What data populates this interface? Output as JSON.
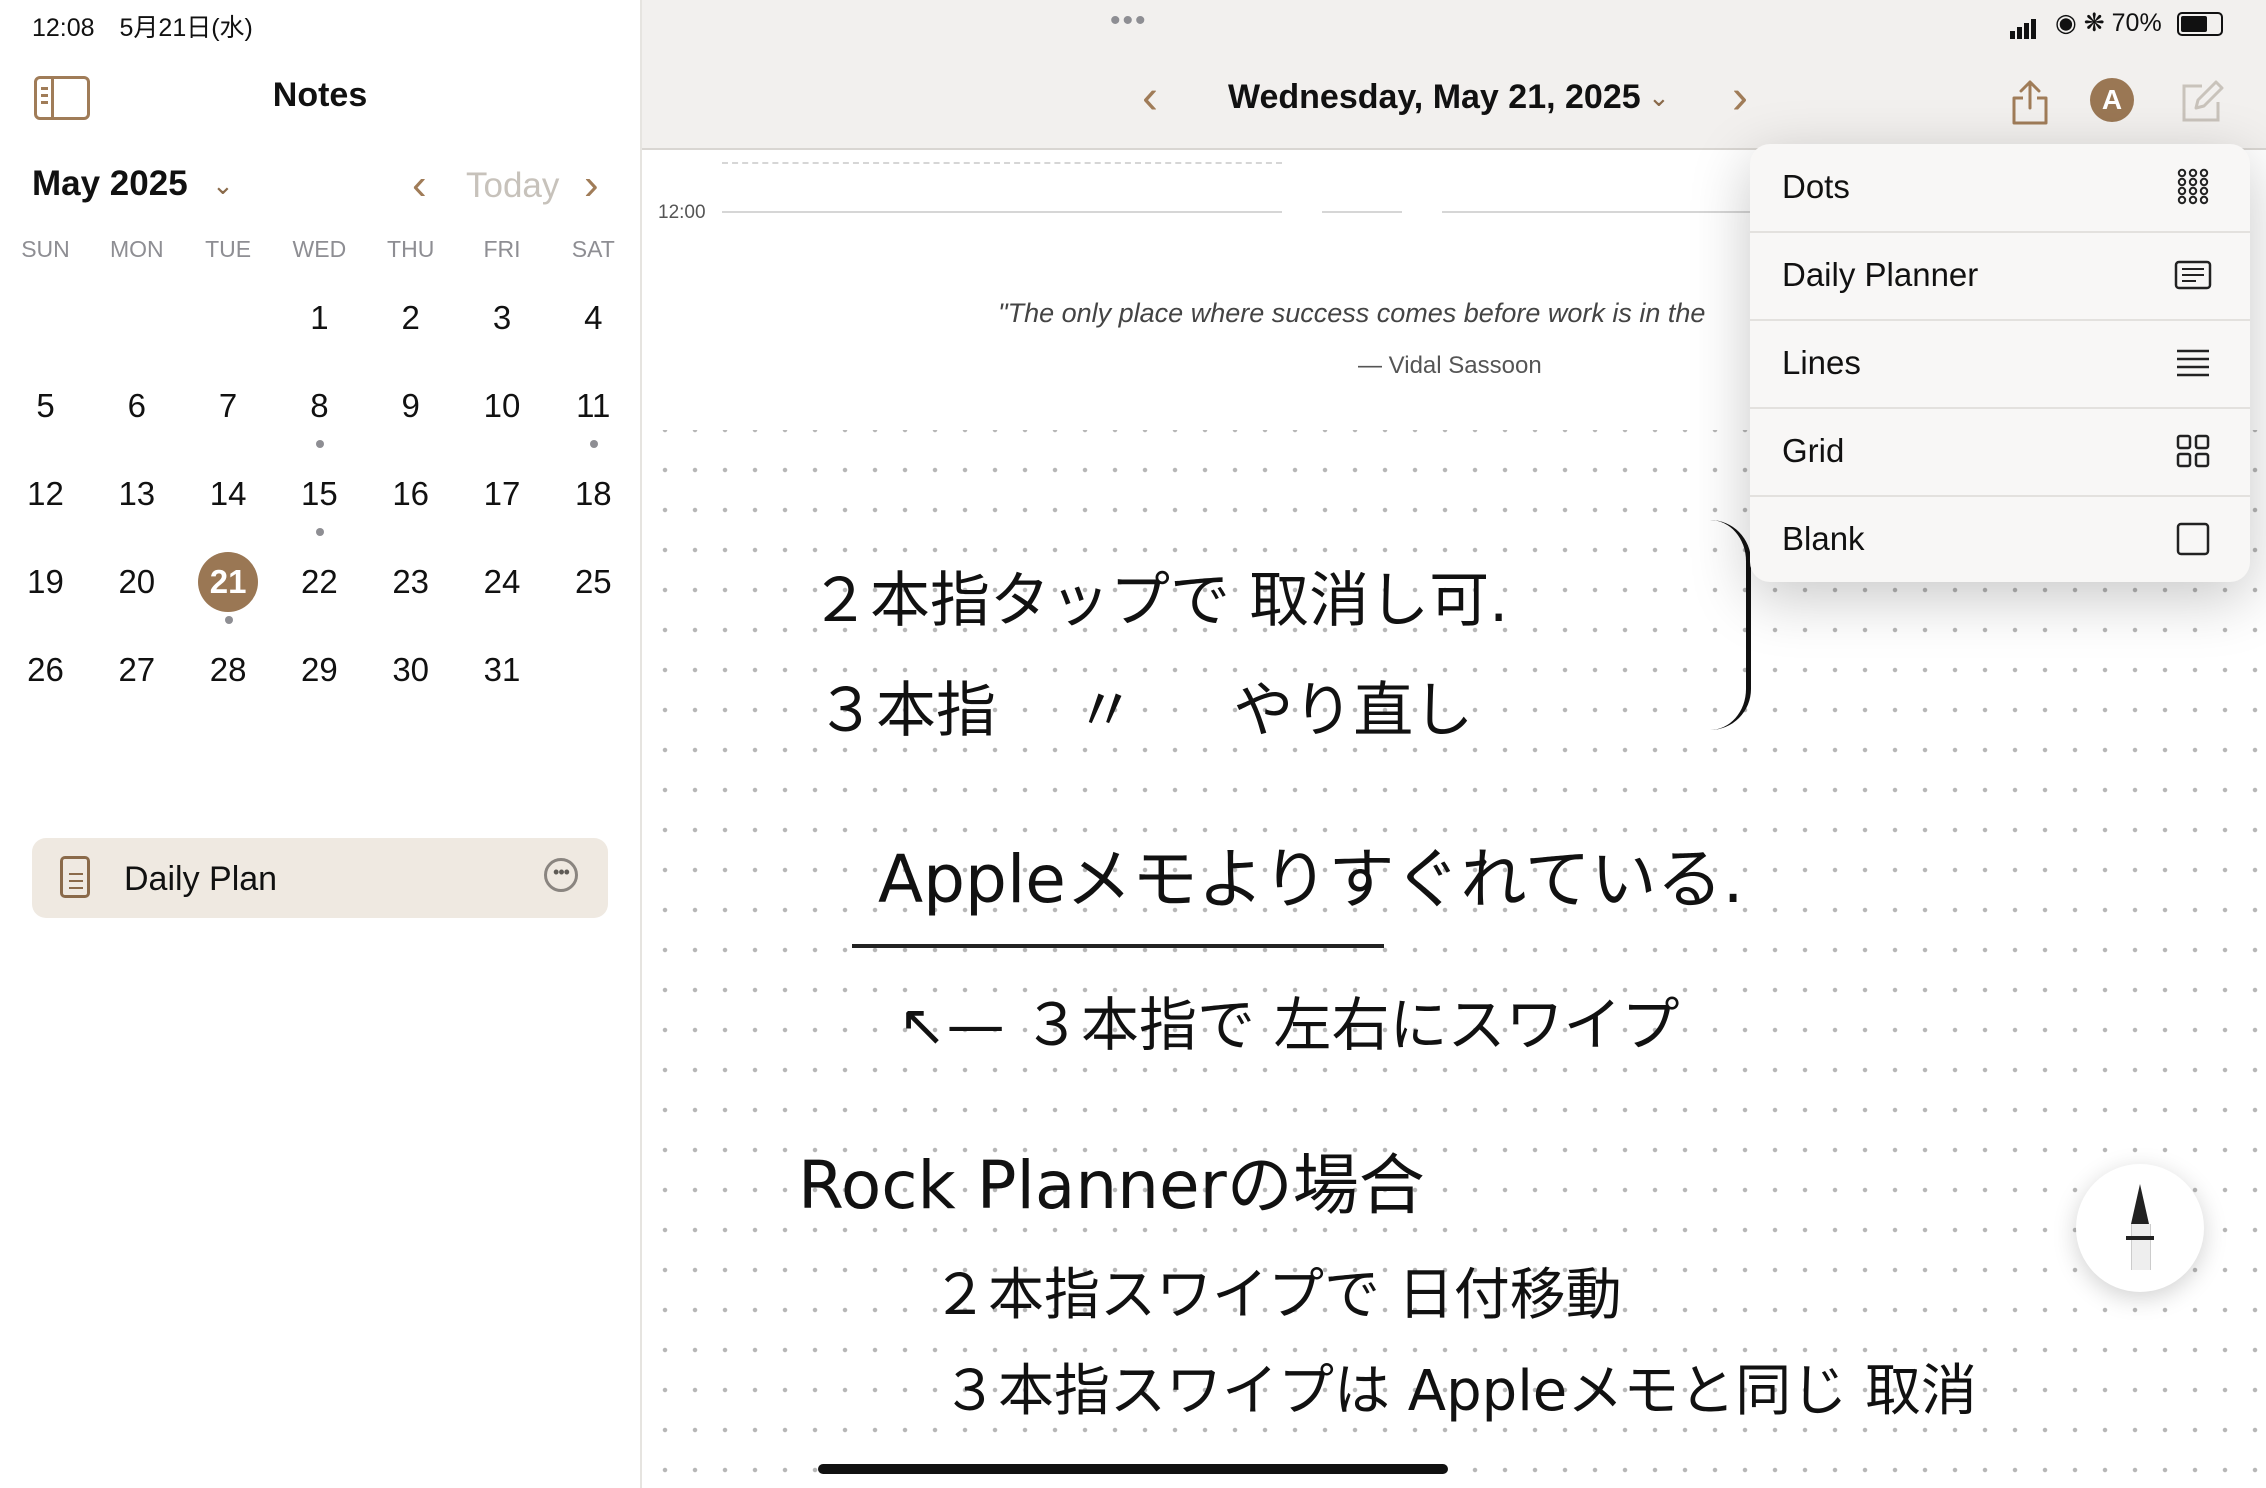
{
  "status": {
    "time": "12:08",
    "date": "5月21日(水)",
    "battery": "70%"
  },
  "sidebar": {
    "title": "Notes",
    "month": "May 2025",
    "today_label": "Today",
    "weekdays": [
      "SUN",
      "MON",
      "TUE",
      "WED",
      "THU",
      "FRI",
      "SAT"
    ],
    "days": [
      "1",
      "2",
      "3",
      "4",
      "5",
      "6",
      "7",
      "8",
      "9",
      "10",
      "11",
      "12",
      "13",
      "14",
      "15",
      "16",
      "17",
      "18",
      "19",
      "20",
      "21",
      "22",
      "23",
      "24",
      "25",
      "26",
      "27",
      "28",
      "29",
      "30",
      "31"
    ],
    "first_weekday": 3,
    "selected_day": "21",
    "days_with_notes": [
      "8",
      "11",
      "15",
      "21"
    ],
    "note": {
      "label": "Daily Plan"
    }
  },
  "header": {
    "date_title": "Wednesday, May 21, 2025",
    "avatar_letter": "A"
  },
  "page": {
    "time_label": "12:00",
    "quote": "\"The only place where success comes before work is in the",
    "quote_author": "— Vidal Sassoon"
  },
  "handwriting": {
    "line1": "２本指タップで 取消し可.",
    "line2": "３本指　 〃 　 やり直し",
    "line3": "Appleメモよりすぐれている.",
    "line4": "↖— ３本指で 左右にスワイプ",
    "line5": "Rock Plannerの場合",
    "line6": "２本指スワイプで 日付移動",
    "line7": "３本指スワイプは Appleメモと同じ 取消"
  },
  "dropdown": {
    "items": [
      {
        "label": "Dots",
        "icon": "dots-icon"
      },
      {
        "label": "Daily Planner",
        "icon": "daily-planner-icon"
      },
      {
        "label": "Lines",
        "icon": "lines-icon"
      },
      {
        "label": "Grid",
        "icon": "grid-icon"
      },
      {
        "label": "Blank",
        "icon": "blank-icon"
      }
    ]
  },
  "colors": {
    "accent": "#9a7754",
    "note_bg": "#efe9e1",
    "toolbar_bg": "#f2f0ee"
  }
}
